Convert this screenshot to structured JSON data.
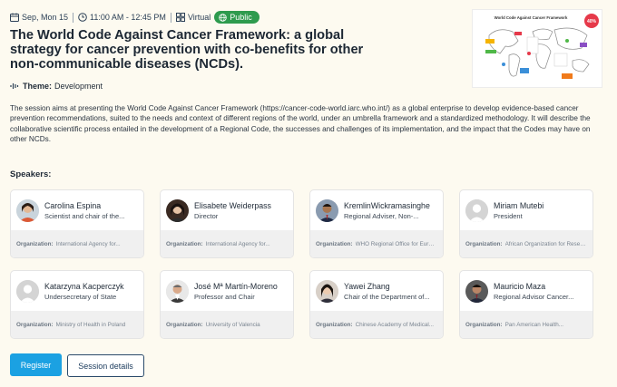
{
  "session": {
    "date": "Sep, Mon 15",
    "time": "11:00 AM - 12:45 PM",
    "format": "Virtual",
    "visibility": "Public",
    "title": "The World Code Against Cancer Framework: a global strategy for cancer prevention with co-benefits for other non-communicable diseases (NCDs).",
    "theme_label": "Theme:",
    "theme_value": "Development",
    "description": "The session aims at presenting the World Code Against Cancer Framework (https://cancer-code-world.iarc.who.int/) as a global enterprise to develop evidence-based cancer prevention recommendations, suited to the needs and context of different regions of the world, under an umbrella framework and a standardized methodology. It will describe the collaborative scientific process entailed in the development of a Regional Code, the successes and challenges of its implementation, and the impact that the Codes may have on other NCDs.",
    "thumbnail_title": "World Code Against Cancer Framework",
    "thumbnail_badge": "40%"
  },
  "speakers_label": "Speakers:",
  "org_label": "Organization:",
  "speakers": [
    {
      "name": "Carolina Espina",
      "role": "Scientist and chair of the...",
      "org": "International Agency for...",
      "avatar": "photo-a"
    },
    {
      "name": "Elisabete Weiderpass",
      "role": "Director",
      "org": "International Agency for...",
      "avatar": "photo-b"
    },
    {
      "name": "KremlinWickramasinghe",
      "role": "Regional Adviser, Non-...",
      "org": "WHO Regional Office for Europe",
      "avatar": "photo-c"
    },
    {
      "name": "Miriam Mutebi",
      "role": "President",
      "org": "African Organization for Resear...",
      "avatar": "placeholder"
    },
    {
      "name": "Katarzyna Kacperczyk",
      "role": "Undersecretary of State",
      "org": "Ministry of Health in Poland",
      "avatar": "placeholder"
    },
    {
      "name": "José Mª Martín-Moreno",
      "role": "Professor and Chair",
      "org": "University of Valencia",
      "avatar": "photo-d"
    },
    {
      "name": "Yawei Zhang",
      "role": "Chair of the Department of...",
      "org": "Chinese Academy of Medical...",
      "avatar": "photo-e"
    },
    {
      "name": "Mauricio Maza",
      "role": "Regional Advisor Cancer...",
      "org": "Pan American Health...",
      "avatar": "photo-f"
    }
  ],
  "actions": {
    "register": "Register",
    "details": "Session details"
  },
  "colors": {
    "background": "#fdfaf0",
    "public_badge": "#2e9b4e",
    "primary_button": "#1ba1e2"
  }
}
